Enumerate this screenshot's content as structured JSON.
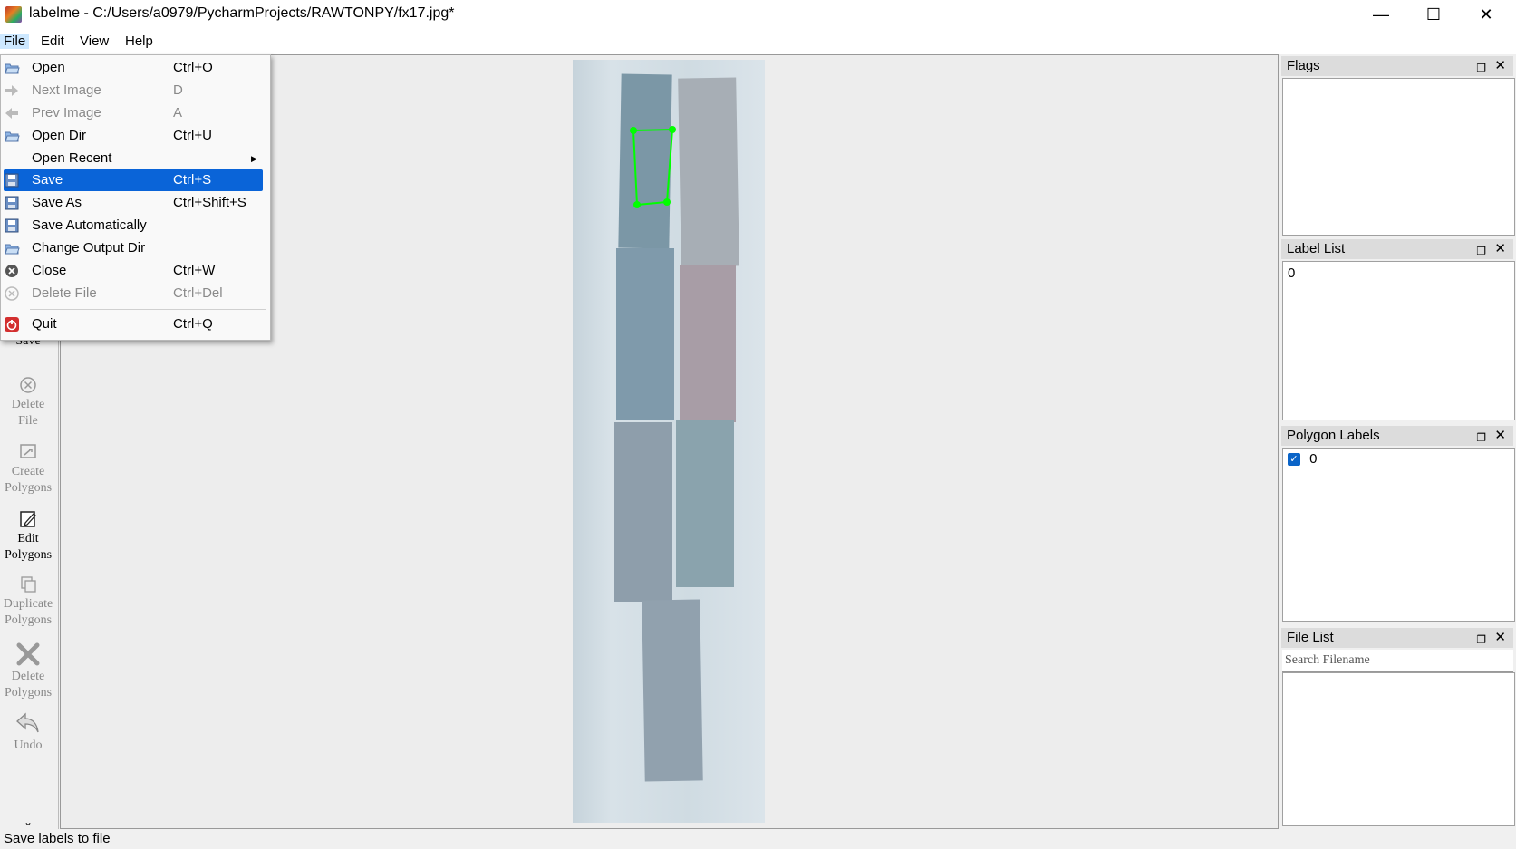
{
  "window": {
    "title": "labelme - C:/Users/a0979/PycharmProjects/RAWTONPY/fx17.jpg*",
    "minimize": "—",
    "maximize": "☐",
    "close": "✕"
  },
  "menubar": {
    "file": "File",
    "edit": "Edit",
    "view": "View",
    "help": "Help"
  },
  "file_menu": {
    "items": [
      {
        "label": "Open",
        "shortcut": "Ctrl+O",
        "icon": "open-folder-icon"
      },
      {
        "label": "Next Image",
        "shortcut": "D",
        "icon": "arrow-right-icon"
      },
      {
        "label": "Prev Image",
        "shortcut": "A",
        "icon": "arrow-left-icon"
      },
      {
        "label": "Open Dir",
        "shortcut": "Ctrl+U",
        "icon": "open-folder-icon"
      },
      {
        "label": "Open Recent",
        "shortcut": "",
        "icon": ""
      },
      {
        "label": "Save",
        "shortcut": "Ctrl+S",
        "icon": "floppy-icon"
      },
      {
        "label": "Save As",
        "shortcut": "Ctrl+Shift+S",
        "icon": "floppy-icon"
      },
      {
        "label": "Save Automatically",
        "shortcut": "",
        "icon": "floppy-icon"
      },
      {
        "label": "Change Output Dir",
        "shortcut": "",
        "icon": "open-folder-icon"
      },
      {
        "label": "Close",
        "shortcut": "Ctrl+W",
        "icon": "close-circle-icon"
      },
      {
        "label": "Delete File",
        "shortcut": "Ctrl+Del",
        "icon": "delete-circle-icon"
      },
      {
        "label": "Quit",
        "shortcut": "Ctrl+Q",
        "icon": "power-icon"
      }
    ],
    "highlighted": "Save"
  },
  "toolbar": {
    "save": "Save",
    "delete_file_1": "Delete",
    "delete_file_2": "File",
    "create_1": "Create",
    "create_2": "Polygons",
    "edit_1": "Edit",
    "edit_2": "Polygons",
    "duplicate_1": "Duplicate",
    "duplicate_2": "Polygons",
    "delete_poly_1": "Delete",
    "delete_poly_2": "Polygons",
    "undo": "Undo",
    "more": "⌄"
  },
  "docks": {
    "flags": {
      "title": "Flags"
    },
    "label_list": {
      "title": "Label List",
      "items": [
        "0"
      ]
    },
    "polygon_labels": {
      "title": "Polygon Labels",
      "items": [
        {
          "label": "0",
          "checked": true
        }
      ]
    },
    "file_list": {
      "title": "File List",
      "search_placeholder": "Search Filename"
    }
  },
  "status_bar": {
    "text": "Save labels to file"
  },
  "colors": {
    "highlight": "#0a64d8",
    "polygon": "#00ff00"
  }
}
